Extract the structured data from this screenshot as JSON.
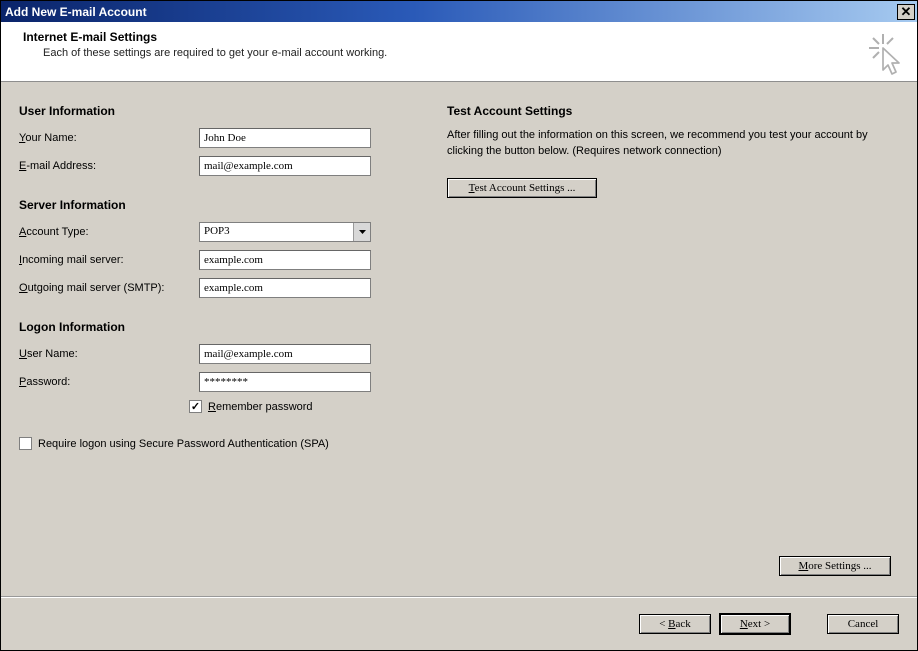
{
  "window": {
    "title": "Add New E-mail Account"
  },
  "header": {
    "title": "Internet E-mail Settings",
    "subtitle": "Each of these settings are required to get your e-mail account working."
  },
  "user_info": {
    "section": "User Information",
    "your_name_label_pre": "Y",
    "your_name_label_post": "our Name:",
    "your_name_value": "John Doe",
    "email_label_pre": "E",
    "email_label_post": "-mail Address:",
    "email_value": "mail@example.com"
  },
  "server_info": {
    "section": "Server Information",
    "acct_type_label_pre": "A",
    "acct_type_label_post": "ccount Type:",
    "acct_type_value": "POP3",
    "incoming_label_pre": "I",
    "incoming_label_post": "ncoming mail server:",
    "incoming_value": "example.com",
    "outgoing_label_pre": "O",
    "outgoing_label_post": "utgoing mail server (SMTP):",
    "outgoing_value": "example.com"
  },
  "logon_info": {
    "section": "Logon Information",
    "user_label_pre": "U",
    "user_label_post": "ser Name:",
    "user_value": "mail@example.com",
    "password_label_pre": "P",
    "password_label_post": "assword:",
    "password_value": "********",
    "remember_pre": "R",
    "remember_post": "emember password",
    "spa_label": "Require logon using Secure Password Authentication (SPA)"
  },
  "test": {
    "section": "Test Account Settings",
    "desc": "After filling out the information on this screen, we recommend you test your account by clicking the button below. (Requires network connection)",
    "btn_pre": "T",
    "btn_post": "est Account Settings ..."
  },
  "more_settings": {
    "pre": "M",
    "post": "ore Settings ..."
  },
  "footer": {
    "back_pre": "< ",
    "back_u": "B",
    "back_post": "ack",
    "next_u": "N",
    "next_post": "ext >",
    "cancel": "Cancel"
  }
}
